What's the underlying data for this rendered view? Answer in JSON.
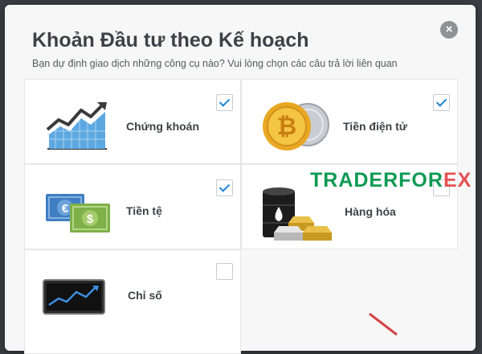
{
  "dialog": {
    "title": "Khoản Đầu tư theo Kế hoạch",
    "subtitle": "Bạn dự định giao dịch những công cụ nào? Vui lòng chọn các câu trả lời liên quan",
    "close_glyph": "×"
  },
  "options": [
    {
      "label": "Chứng khoán",
      "icon": "stock-chart-icon",
      "checked": true
    },
    {
      "label": "Tiền điện tử",
      "icon": "crypto-coins-icon",
      "checked": true
    },
    {
      "label": "Tiền tệ",
      "icon": "currency-notes-icon",
      "checked": true
    },
    {
      "label": "Hàng hóa",
      "icon": "commodities-icon",
      "checked": false
    },
    {
      "label": "Chỉ số",
      "icon": "index-chart-icon",
      "checked": false
    }
  ],
  "watermark": {
    "part1": "TRADERFOR",
    "part2": "EX"
  },
  "colors": {
    "check": "#1f84d6",
    "title": "#3e4147",
    "watermark_green": "#0e9a54",
    "watermark_red": "#e45252"
  }
}
